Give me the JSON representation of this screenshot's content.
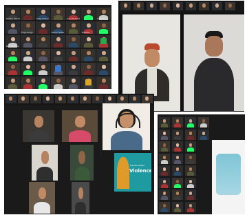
{
  "panels": {
    "top_left": {
      "tiles": [
        {
          "name": "Sheikh Shamim",
          "bg": "#2e2e2e",
          "kind": "face"
        },
        {
          "name": "",
          "bg": "#3a3a3a",
          "kind": "face"
        },
        {
          "name": "Vijay Kumar",
          "bg": "#2e2e2e",
          "kind": "face"
        },
        {
          "name": "",
          "bg": "#2e2e2e",
          "kind": "face"
        },
        {
          "name": "Anuj Sharma",
          "bg": "#2e2e2e",
          "kind": "face"
        },
        {
          "name": "",
          "bg": "#2e2e2e",
          "kind": "face"
        },
        {
          "name": "Vijay Rani",
          "bg": "#2e2e2e",
          "kind": "face"
        },
        {
          "name": "",
          "bg": "#2e2e2e",
          "kind": "face"
        },
        {
          "name": "Priya Singh",
          "bg": "#2e2e2e",
          "kind": "face"
        },
        {
          "name": "",
          "bg": "#2e2e2e",
          "kind": "face"
        },
        {
          "name": "Rahul Yadav",
          "bg": "#2e2e2e",
          "kind": "face"
        },
        {
          "name": "",
          "bg": "#2e2e2e",
          "kind": "face"
        },
        {
          "name": "Deepak",
          "bg": "#2e2e2e",
          "kind": "face"
        },
        {
          "name": "",
          "bg": "#2e2e2e",
          "kind": "face"
        },
        {
          "name": "Neha Gupta",
          "bg": "#2e2e2e",
          "kind": "face"
        },
        {
          "name": "",
          "bg": "#2e2e2e",
          "kind": "face"
        },
        {
          "name": "",
          "bg": "#2e2e2e",
          "kind": "face"
        },
        {
          "name": "",
          "bg": "#2e2e2e",
          "kind": "face"
        },
        {
          "name": "",
          "bg": "#2e2e2e",
          "kind": "face"
        },
        {
          "name": "",
          "bg": "#2e2e2e",
          "kind": "face"
        },
        {
          "name": "",
          "bg": "#2e2e2e",
          "kind": "face"
        },
        {
          "name": "",
          "bg": "#2e2e2e",
          "kind": "face"
        },
        {
          "name": "",
          "bg": "#2e2e2e",
          "kind": "face"
        },
        {
          "name": "",
          "bg": "#2e2e2e",
          "kind": "face"
        },
        {
          "name": "",
          "bg": "#2e2e2e",
          "kind": "face"
        },
        {
          "name": "",
          "bg": "#2e2e2e",
          "kind": "face"
        },
        {
          "name": "",
          "bg": "#2e2e2e",
          "kind": "face"
        },
        {
          "name": "",
          "bg": "#2e2e2e",
          "kind": "face"
        },
        {
          "name": "",
          "bg": "#2e2e2e",
          "kind": "face"
        },
        {
          "name": "",
          "bg": "#2e2e2e",
          "kind": "face"
        },
        {
          "name": "",
          "bg": "#2e2e2e",
          "kind": "face"
        },
        {
          "name": "",
          "bg": "#2e2e2e",
          "kind": "face"
        },
        {
          "name": "",
          "bg": "#2e2e2e",
          "kind": "face"
        },
        {
          "name": "",
          "bg": "#2e2e2e",
          "kind": "face"
        },
        {
          "name": "",
          "bg": "#2e2e2e",
          "kind": "face"
        },
        {
          "name": "",
          "bg": "#2e2e2e",
          "kind": "face"
        },
        {
          "name": "",
          "bg": "#2e2e2e",
          "kind": "face"
        },
        {
          "name": "",
          "bg": "#2e2e2e",
          "kind": "face"
        },
        {
          "name": "",
          "bg": "#2e2e2e",
          "kind": "face"
        },
        {
          "name": "",
          "bg": "#2e2e2e",
          "kind": "face"
        },
        {
          "name": "",
          "bg": "#2e2e2e",
          "kind": "face"
        },
        {
          "name": "",
          "bg": "#2e2e2e",
          "kind": "face"
        },
        {
          "name": "",
          "bg": "#2e2e2e",
          "kind": "face"
        },
        {
          "name": "",
          "bg": "#2e2e2e",
          "kind": "face"
        },
        {
          "name": "",
          "bg": "#2e2e2e",
          "kind": "face"
        },
        {
          "name": "",
          "bg": "#2e2e2e",
          "kind": "face"
        },
        {
          "name": "",
          "bg": "#2e2e2e",
          "kind": "face"
        },
        {
          "name": "",
          "bg": "#2e2e2e",
          "kind": "face"
        }
      ]
    },
    "top_right": {
      "strip_names": [
        "",
        "",
        "",
        "",
        "",
        "",
        "",
        "",
        ""
      ],
      "speaker_left_name": "",
      "speaker_right_name": ""
    },
    "bottom_left": {
      "strip_names": [
        "",
        "",
        "",
        "",
        "",
        "",
        "",
        "",
        "",
        "",
        "",
        ""
      ],
      "tiles": [
        {
          "name": "",
          "kind": "face"
        },
        {
          "name": "",
          "kind": "face"
        },
        {
          "name": "",
          "kind": "presenter"
        },
        {
          "name": "",
          "kind": "face"
        },
        {
          "name": "",
          "kind": "face"
        },
        {
          "name": "",
          "kind": "face"
        },
        {
          "name": "",
          "kind": "face"
        },
        {
          "name": "",
          "kind": "face"
        }
      ],
      "poster_word": "Violence",
      "poster_subword": "Gender based"
    },
    "bottom_right": {
      "poster_title": "",
      "tiles": [
        "",
        "",
        "",
        "",
        "",
        "",
        "",
        "",
        "",
        "",
        "",
        "",
        "",
        "",
        "",
        "",
        "",
        "",
        "",
        ""
      ]
    }
  },
  "colors": {
    "dark": "#1b1b1b",
    "tile": "#2e2e2e",
    "teal": "#1f9aa0",
    "poster_orange": "#e09a2a",
    "wall": "#e9e6df"
  }
}
